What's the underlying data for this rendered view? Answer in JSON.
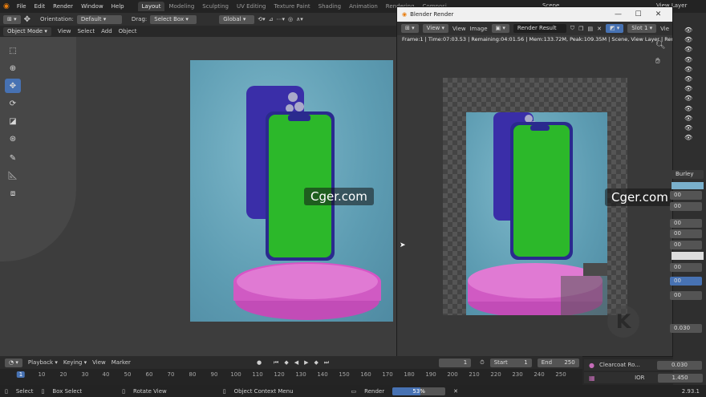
{
  "menu": {
    "items": [
      "File",
      "Edit",
      "Render",
      "Window",
      "Help"
    ]
  },
  "workspaces": {
    "tabs": [
      "Layout",
      "Modeling",
      "Sculpting",
      "UV Editing",
      "Texture Paint",
      "Shading",
      "Animation",
      "Rendering",
      "Composi"
    ],
    "active": 0,
    "scene_label": "Scene",
    "view_layer": "View Layer"
  },
  "header": {
    "orientation_label": "Orientation:",
    "orientation_value": "Default",
    "drag_label": "Drag:",
    "drag_value": "Select Box",
    "transform_space": "Global"
  },
  "mode_bar": {
    "mode": "Object Mode",
    "items": [
      "View",
      "Select",
      "Add",
      "Object"
    ]
  },
  "render_window": {
    "title": "Blender Render",
    "view_menu": "View",
    "menu_items": [
      "View",
      "Image"
    ],
    "image_name": "Render Result",
    "slot": "Slot 1",
    "extra": "Vie",
    "status_text": "Frame:1 | Time:07:03.53 | Remaining:04:01.56 | Mem:133.72M, Peak:109.35M | Scene, View Layer | Rendered 182/"
  },
  "watermark": {
    "text": "Cger.com"
  },
  "timeline": {
    "menu": [
      "Playback",
      "Keying",
      "View",
      "Marker"
    ],
    "current_frame": "1",
    "start_label": "Start",
    "start_value": "1",
    "end_label": "End",
    "end_value": "250",
    "ticks": [
      "1",
      "10",
      "20",
      "30",
      "40",
      "50",
      "60",
      "70",
      "80",
      "90",
      "100",
      "110",
      "120",
      "130",
      "140",
      "150",
      "160",
      "170",
      "180",
      "190",
      "200",
      "210",
      "220",
      "230",
      "240",
      "250"
    ]
  },
  "properties": {
    "subsurface_method": "Burley",
    "values": [
      "00",
      "00",
      "00",
      "00",
      "00",
      "00",
      "00",
      "00"
    ],
    "clearcoat_label": "Clearcoat Ro...",
    "clearcoat_value": "0.030",
    "ior_label": "IOR",
    "ior_value": "1.450",
    "partial_value": "0.030"
  },
  "statusbar": {
    "select": "Select",
    "box_select": "Box Select",
    "rotate_view": "Rotate View",
    "context_menu": "Object Context Menu",
    "render_label": "Render",
    "progress_text": "53%",
    "progress": 0.53,
    "version": "2.93.1"
  },
  "colors": {
    "accent": "#4772b3",
    "phone_green": "#2cb82a",
    "phone_purple": "#3a2ea8",
    "pedestal": "#d755c6",
    "background_teal": "#5f9fb4"
  }
}
